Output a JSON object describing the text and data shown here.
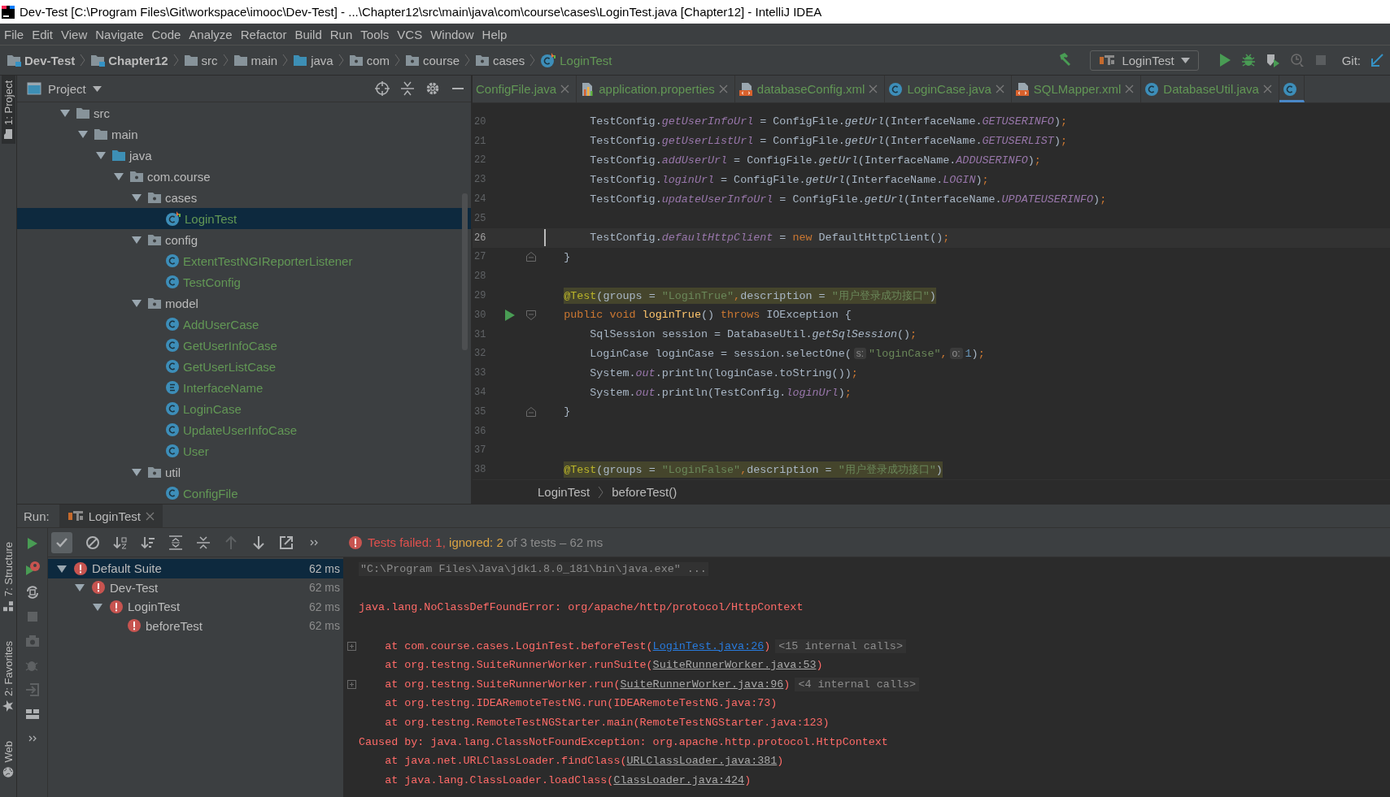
{
  "window": {
    "title": "Dev-Test [C:\\Program Files\\Git\\workspace\\imooc\\Dev-Test] - ...\\Chapter12\\src\\main\\java\\com\\course\\cases\\LoginTest.java [Chapter12] - IntelliJ IDEA"
  },
  "menu": [
    "File",
    "Edit",
    "View",
    "Navigate",
    "Code",
    "Analyze",
    "Refactor",
    "Build",
    "Run",
    "Tools",
    "VCS",
    "Window",
    "Help"
  ],
  "nav_path": [
    {
      "label": "Dev-Test",
      "kind": "module"
    },
    {
      "label": "Chapter12",
      "kind": "module"
    },
    {
      "label": "src",
      "kind": "folder"
    },
    {
      "label": "main",
      "kind": "folder"
    },
    {
      "label": "java",
      "kind": "source"
    },
    {
      "label": "com",
      "kind": "package"
    },
    {
      "label": "course",
      "kind": "package"
    },
    {
      "label": "cases",
      "kind": "package"
    },
    {
      "label": "LoginTest",
      "kind": "test-class"
    }
  ],
  "run_config": {
    "label": "LoginTest"
  },
  "git": {
    "label": "Git:"
  },
  "side_tabs": [
    {
      "label": "1: Project",
      "selected": true
    },
    {
      "label": "7: Structure",
      "selected": false
    },
    {
      "label": "2: Favorites",
      "selected": false
    },
    {
      "label": "Web",
      "selected": false
    }
  ],
  "project": {
    "title": "Project",
    "tree": [
      {
        "label": "src",
        "kind": "folder",
        "expanded": true,
        "selected": false,
        "children": [
          {
            "label": "main",
            "kind": "folder",
            "expanded": true,
            "selected": false,
            "children": [
              {
                "label": "java",
                "kind": "source",
                "expanded": true,
                "selected": false,
                "children": [
                  {
                    "label": "com.course",
                    "kind": "package",
                    "expanded": true,
                    "selected": false,
                    "children": [
                      {
                        "label": "cases",
                        "kind": "package",
                        "expanded": true,
                        "selected": false,
                        "children": [
                          {
                            "label": "LoginTest",
                            "kind": "test-class",
                            "selected": true
                          }
                        ]
                      },
                      {
                        "label": "config",
                        "kind": "package",
                        "expanded": true,
                        "selected": false,
                        "children": [
                          {
                            "label": "ExtentTestNGIReporterListener",
                            "kind": "class",
                            "selected": false
                          },
                          {
                            "label": "TestConfig",
                            "kind": "class",
                            "selected": false
                          }
                        ]
                      },
                      {
                        "label": "model",
                        "kind": "package",
                        "expanded": true,
                        "selected": false,
                        "children": [
                          {
                            "label": "AddUserCase",
                            "kind": "class",
                            "selected": false
                          },
                          {
                            "label": "GetUserInfoCase",
                            "kind": "class",
                            "selected": false
                          },
                          {
                            "label": "GetUserListCase",
                            "kind": "class",
                            "selected": false
                          },
                          {
                            "label": "InterfaceName",
                            "kind": "enum",
                            "selected": false
                          },
                          {
                            "label": "LoginCase",
                            "kind": "class",
                            "selected": false
                          },
                          {
                            "label": "UpdateUserInfoCase",
                            "kind": "class",
                            "selected": false
                          },
                          {
                            "label": "User",
                            "kind": "class",
                            "selected": false
                          }
                        ]
                      },
                      {
                        "label": "util",
                        "kind": "package",
                        "expanded": true,
                        "selected": false,
                        "children": [
                          {
                            "label": "ConfigFile",
                            "kind": "class",
                            "selected": false
                          }
                        ]
                      }
                    ]
                  }
                ]
              }
            ]
          }
        ]
      }
    ]
  },
  "editor": {
    "tabs": [
      {
        "label": "ConfigFile.java",
        "kind": "plain",
        "selected": false
      },
      {
        "label": "application.properties",
        "kind": "properties",
        "selected": false
      },
      {
        "label": "databaseConfig.xml",
        "kind": "xml",
        "selected": false
      },
      {
        "label": "LoginCase.java",
        "kind": "class",
        "selected": false
      },
      {
        "label": "SQLMapper.xml",
        "kind": "xml",
        "selected": false
      },
      {
        "label": "DatabaseUtil.java",
        "kind": "class",
        "selected": false
      },
      {
        "kind": "class",
        "selected": true
      }
    ],
    "lines": [
      {
        "number": "20",
        "current": false,
        "highlighted": false,
        "runnable": false,
        "fold_start": false,
        "fold_end": false,
        "tokens": [
          {
            "text": "        TestConfig.",
            "kind": "plain"
          },
          {
            "text": "getUserInfoUrl",
            "kind": "field"
          },
          {
            "text": " = ConfigFile.",
            "kind": "plain"
          },
          {
            "text": "getUrl",
            "kind": "smethod"
          },
          {
            "text": "(InterfaceName.",
            "kind": "plain"
          },
          {
            "text": "GETUSERINFO",
            "kind": "field"
          },
          {
            "text": ")",
            "kind": "plain"
          },
          {
            "text": ";",
            "kind": "punct"
          }
        ]
      },
      {
        "number": "21",
        "current": false,
        "highlighted": false,
        "runnable": false,
        "fold_start": false,
        "fold_end": false,
        "tokens": [
          {
            "text": "        TestConfig.",
            "kind": "plain"
          },
          {
            "text": "getUserListUrl",
            "kind": "field"
          },
          {
            "text": " = ConfigFile.",
            "kind": "plain"
          },
          {
            "text": "getUrl",
            "kind": "smethod"
          },
          {
            "text": "(InterfaceName.",
            "kind": "plain"
          },
          {
            "text": "GETUSERLIST",
            "kind": "field"
          },
          {
            "text": ")",
            "kind": "plain"
          },
          {
            "text": ";",
            "kind": "punct"
          }
        ]
      },
      {
        "number": "22",
        "current": false,
        "highlighted": false,
        "runnable": false,
        "fold_start": false,
        "fold_end": false,
        "tokens": [
          {
            "text": "        TestConfig.",
            "kind": "plain"
          },
          {
            "text": "addUserUrl",
            "kind": "field"
          },
          {
            "text": " = ConfigFile.",
            "kind": "plain"
          },
          {
            "text": "getUrl",
            "kind": "smethod"
          },
          {
            "text": "(InterfaceName.",
            "kind": "plain"
          },
          {
            "text": "ADDUSERINFO",
            "kind": "field"
          },
          {
            "text": ")",
            "kind": "plain"
          },
          {
            "text": ";",
            "kind": "punct"
          }
        ]
      },
      {
        "number": "23",
        "current": false,
        "highlighted": false,
        "runnable": false,
        "fold_start": false,
        "fold_end": false,
        "tokens": [
          {
            "text": "        TestConfig.",
            "kind": "plain"
          },
          {
            "text": "loginUrl",
            "kind": "field"
          },
          {
            "text": " = ConfigFile.",
            "kind": "plain"
          },
          {
            "text": "getUrl",
            "kind": "smethod"
          },
          {
            "text": "(InterfaceName.",
            "kind": "plain"
          },
          {
            "text": "LOGIN",
            "kind": "field"
          },
          {
            "text": ")",
            "kind": "plain"
          },
          {
            "text": ";",
            "kind": "punct"
          }
        ]
      },
      {
        "number": "24",
        "current": false,
        "highlighted": false,
        "runnable": false,
        "fold_start": false,
        "fold_end": false,
        "tokens": [
          {
            "text": "        TestConfig.",
            "kind": "plain"
          },
          {
            "text": "updateUserInfoUrl",
            "kind": "field"
          },
          {
            "text": " = ConfigFile.",
            "kind": "plain"
          },
          {
            "text": "getUrl",
            "kind": "smethod"
          },
          {
            "text": "(InterfaceName.",
            "kind": "plain"
          },
          {
            "text": "UPDATEUSERINFO",
            "kind": "field"
          },
          {
            "text": ")",
            "kind": "plain"
          },
          {
            "text": ";",
            "kind": "punct"
          }
        ]
      },
      {
        "number": "25",
        "current": false,
        "runnable": false,
        "fold_start": false,
        "fold_end": false
      },
      {
        "number": "26",
        "current": true,
        "highlighted": false,
        "runnable": false,
        "fold_start": false,
        "fold_end": false,
        "tokens": [
          {
            "text": "        TestConfig.",
            "kind": "plain"
          },
          {
            "text": "defaultHttpClient",
            "kind": "field"
          },
          {
            "text": " = ",
            "kind": "plain"
          },
          {
            "text": "new",
            "kind": "keyword"
          },
          {
            "text": " DefaultHttpClient()",
            "kind": "plain"
          },
          {
            "text": ";",
            "kind": "punct"
          }
        ]
      },
      {
        "number": "27",
        "current": false,
        "highlighted": false,
        "runnable": false,
        "fold_start": false,
        "fold_end": true,
        "tokens": [
          {
            "text": "    }",
            "kind": "plain"
          }
        ]
      },
      {
        "number": "28",
        "current": false,
        "runnable": false,
        "fold_start": false,
        "fold_end": false
      },
      {
        "number": "29",
        "current": false,
        "highlighted": true,
        "runnable": false,
        "fold_start": false,
        "fold_end": false,
        "tokens": [
          {
            "text": "    @Test",
            "kind": "annotation"
          },
          {
            "text": "(groups = ",
            "kind": "plain"
          },
          {
            "text": "\"LoginTrue\"",
            "kind": "string"
          },
          {
            "text": ",",
            "kind": "punct"
          },
          {
            "text": "description = ",
            "kind": "plain"
          },
          {
            "text": "\"用户登录成功接口\"",
            "kind": "string"
          },
          {
            "text": ")",
            "kind": "plain"
          }
        ]
      },
      {
        "number": "30",
        "current": false,
        "highlighted": false,
        "runnable": true,
        "fold_start": true,
        "fold_end": false,
        "tokens": [
          {
            "text": "    public void ",
            "kind": "keyword"
          },
          {
            "text": "loginTrue",
            "kind": "decl"
          },
          {
            "text": "() ",
            "kind": "plain"
          },
          {
            "text": "throws ",
            "kind": "keyword"
          },
          {
            "text": "IOException {",
            "kind": "plain"
          }
        ]
      },
      {
        "number": "31",
        "current": false,
        "highlighted": false,
        "runnable": false,
        "fold_start": false,
        "fold_end": false,
        "tokens": [
          {
            "text": "        SqlSession session = DatabaseUtil.",
            "kind": "plain"
          },
          {
            "text": "getSqlSession",
            "kind": "smethod"
          },
          {
            "text": "()",
            "kind": "plain"
          },
          {
            "text": ";",
            "kind": "punct"
          }
        ]
      },
      {
        "number": "32",
        "current": false,
        "highlighted": false,
        "runnable": false,
        "fold_start": false,
        "fold_end": false,
        "tokens": [
          {
            "text": "        LoginCase loginCase = session.selectOne(",
            "kind": "plain"
          },
          {
            "text": "s:",
            "kind": "hint"
          },
          {
            "text": "\"loginCase\"",
            "kind": "string"
          },
          {
            "text": ",",
            "kind": "punct"
          },
          {
            "text": "o:",
            "kind": "hint"
          },
          {
            "text": "1",
            "kind": "number"
          },
          {
            "text": ")",
            "kind": "plain"
          },
          {
            "text": ";",
            "kind": "punct"
          }
        ]
      },
      {
        "number": "33",
        "current": false,
        "highlighted": false,
        "runnable": false,
        "fold_start": false,
        "fold_end": false,
        "tokens": [
          {
            "text": "        System.",
            "kind": "plain"
          },
          {
            "text": "out",
            "kind": "field"
          },
          {
            "text": ".println(loginCase.toString())",
            "kind": "plain"
          },
          {
            "text": ";",
            "kind": "punct"
          }
        ]
      },
      {
        "number": "34",
        "current": false,
        "highlighted": false,
        "runnable": false,
        "fold_start": false,
        "fold_end": false,
        "tokens": [
          {
            "text": "        System.",
            "kind": "plain"
          },
          {
            "text": "out",
            "kind": "field"
          },
          {
            "text": ".println(TestConfig.",
            "kind": "plain"
          },
          {
            "text": "loginUrl",
            "kind": "field"
          },
          {
            "text": ")",
            "kind": "plain"
          },
          {
            "text": ";",
            "kind": "punct"
          }
        ]
      },
      {
        "number": "35",
        "current": false,
        "highlighted": false,
        "runnable": false,
        "fold_start": false,
        "fold_end": true,
        "tokens": [
          {
            "text": "    }",
            "kind": "plain"
          }
        ]
      },
      {
        "number": "36",
        "current": false,
        "runnable": false,
        "fold_start": false,
        "fold_end": false
      },
      {
        "number": "37",
        "current": false,
        "runnable": false,
        "fold_start": false,
        "fold_end": false
      },
      {
        "number": "38",
        "current": false,
        "highlighted": true,
        "runnable": false,
        "fold_start": false,
        "fold_end": false,
        "tokens": [
          {
            "text": "    @Test",
            "kind": "annotation"
          },
          {
            "text": "(groups = ",
            "kind": "plain"
          },
          {
            "text": "\"LoginFalse\"",
            "kind": "string"
          },
          {
            "text": ",",
            "kind": "punct"
          },
          {
            "text": "description = ",
            "kind": "plain"
          },
          {
            "text": "\"用户登录成功接口\"",
            "kind": "string"
          },
          {
            "text": ")",
            "kind": "plain"
          }
        ]
      }
    ],
    "breadcrumbs": [
      "LoginTest",
      "beforeTest()"
    ]
  },
  "run": {
    "label": "Run:",
    "tab": {
      "label": "LoginTest"
    },
    "show_passed": true,
    "status": [
      {
        "text": "Tests failed: 1, ",
        "kind": "failed"
      },
      {
        "text": "ignored: 2 ",
        "kind": "ignored"
      },
      {
        "text": "of 3 tests – 62 ms",
        "kind": "plain"
      }
    ],
    "tree": [
      {
        "label": "Default Suite",
        "failed": true,
        "time": "62 ms",
        "expanded": true,
        "selected": true,
        "children": [
          {
            "label": "Dev-Test",
            "failed": true,
            "time": "62 ms",
            "expanded": true,
            "selected": false,
            "children": [
              {
                "label": "LoginTest",
                "failed": true,
                "time": "62 ms",
                "expanded": true,
                "selected": false,
                "children": [
                  {
                    "label": "beforeTest",
                    "failed": true,
                    "time": "62 ms",
                    "selected": false
                  }
                ]
              }
            ]
          }
        ]
      }
    ],
    "console": [
      {
        "segments": [
          {
            "text": "\"C:\\Program Files\\Java\\jdk1.8.0_181\\bin\\java.exe\" ...",
            "kind": "command"
          }
        ]
      },
      {
        "space_before": true,
        "segments": [
          {
            "text": "java.lang.NoClassDefFoundError: org/apache/http/protocol/HttpContext",
            "kind": "error"
          }
        ]
      },
      {
        "space_before": true,
        "folded_calls": "<15 internal calls>",
        "segments": [
          {
            "text": "    at com.course.cases.LoginTest.beforeTest(",
            "kind": "error"
          },
          {
            "text": "LoginTest.java:26",
            "kind": "link"
          },
          {
            "text": ")",
            "kind": "error"
          }
        ]
      },
      {
        "segments": [
          {
            "text": "    at org.testng.SuiteRunnerWorker.runSuite(",
            "kind": "error"
          },
          {
            "text": "SuiteRunnerWorker.java:53",
            "kind": "library-link"
          },
          {
            "text": ")",
            "kind": "error"
          }
        ]
      },
      {
        "folded_calls": "<4 internal calls>",
        "segments": [
          {
            "text": "    at org.testng.SuiteRunnerWorker.run(",
            "kind": "error"
          },
          {
            "text": "SuiteRunnerWorker.java:96",
            "kind": "library-link"
          },
          {
            "text": ")",
            "kind": "error"
          }
        ]
      },
      {
        "segments": [
          {
            "text": "    at org.testng.IDEARemoteTestNG.run(IDEARemoteTestNG.java:73)",
            "kind": "error"
          }
        ]
      },
      {
        "segments": [
          {
            "text": "    at org.testng.RemoteTestNGStarter.main(RemoteTestNGStarter.java:123)",
            "kind": "error"
          }
        ]
      },
      {
        "segments": [
          {
            "text": "Caused by: java.lang.ClassNotFoundException: org.apache.http.protocol.HttpContext",
            "kind": "error"
          }
        ]
      },
      {
        "segments": [
          {
            "text": "    at java.net.URLClassLoader.findClass(",
            "kind": "error"
          },
          {
            "text": "URLClassLoader.java:381",
            "kind": "library-link"
          },
          {
            "text": ")",
            "kind": "error"
          }
        ]
      },
      {
        "segments": [
          {
            "text": "    at java.lang.ClassLoader.loadClass(",
            "kind": "error"
          },
          {
            "text": "ClassLoader.java:424",
            "kind": "library-link"
          },
          {
            "text": ")",
            "kind": "error"
          }
        ]
      }
    ]
  }
}
